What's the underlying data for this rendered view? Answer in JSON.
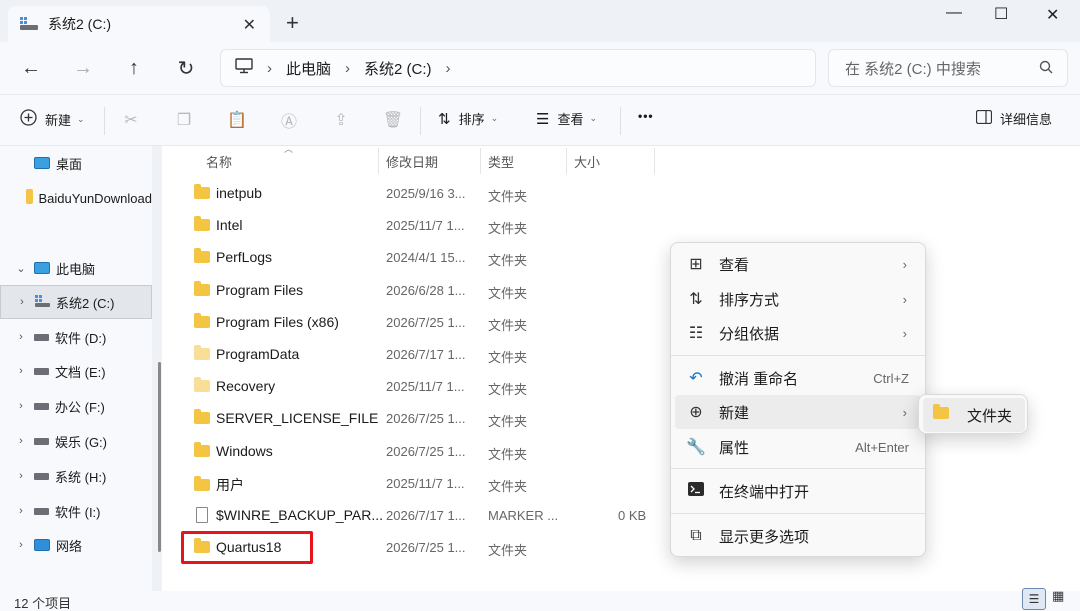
{
  "window": {
    "tab_title": "系统2 (C:)",
    "close_tab": "✕",
    "new_tab": "+",
    "minimize": "—",
    "maximize": "☐",
    "close": "✕"
  },
  "nav": {
    "back": "←",
    "forward": "→",
    "up": "↑",
    "refresh": "↻",
    "breadcrumb": [
      "此电脑",
      "系统2 (C:)"
    ],
    "search_placeholder": "在 系统2 (C:) 中搜索"
  },
  "toolbar": {
    "new_label": "新建",
    "sort_label": "排序",
    "view_label": "查看",
    "more_label": "•••",
    "details_label": "详细信息"
  },
  "sidebar": {
    "items": [
      {
        "label": "桌面"
      },
      {
        "label": "BaiduYunDownload"
      },
      {
        "label": "此电脑"
      },
      {
        "label": "系统2 (C:)"
      },
      {
        "label": "软件 (D:)"
      },
      {
        "label": "文档 (E:)"
      },
      {
        "label": "办公 (F:)"
      },
      {
        "label": "娱乐 (G:)"
      },
      {
        "label": "系统 (H:)"
      },
      {
        "label": "软件 (I:)"
      },
      {
        "label": "网络"
      }
    ]
  },
  "columns": {
    "name": "名称",
    "date": "修改日期",
    "type": "类型",
    "size": "大小"
  },
  "files": [
    {
      "name": "inetpub",
      "date": "2025/9/16 3...",
      "type": "文件夹",
      "size": ""
    },
    {
      "name": "Intel",
      "date": "2025/11/7 1...",
      "type": "文件夹",
      "size": ""
    },
    {
      "name": "PerfLogs",
      "date": "2024/4/1 15...",
      "type": "文件夹",
      "size": ""
    },
    {
      "name": "Program Files",
      "date": "2026/6/28 1...",
      "type": "文件夹",
      "size": ""
    },
    {
      "name": "Program Files (x86)",
      "date": "2026/7/25 1...",
      "type": "文件夹",
      "size": ""
    },
    {
      "name": "ProgramData",
      "date": "2026/7/17 1...",
      "type": "文件夹",
      "size": ""
    },
    {
      "name": "Recovery",
      "date": "2025/11/7 1...",
      "type": "文件夹",
      "size": ""
    },
    {
      "name": "SERVER_LICENSE_FILE",
      "date": "2026/7/25 1...",
      "type": "文件夹",
      "size": ""
    },
    {
      "name": "Windows",
      "date": "2026/7/25 1...",
      "type": "文件夹",
      "size": ""
    },
    {
      "name": "用户",
      "date": "2025/11/7 1...",
      "type": "文件夹",
      "size": ""
    },
    {
      "name": "$WINRE_BACKUP_PAR...",
      "date": "2026/7/17 1...",
      "type": "MARKER ...",
      "size": "0 KB"
    },
    {
      "name": "Quartus18",
      "date": "2026/7/25 1...",
      "type": "文件夹",
      "size": ""
    }
  ],
  "status": {
    "item_count": "12 个项目"
  },
  "context_menu": {
    "items": [
      {
        "label": "查看",
        "shortcut": ""
      },
      {
        "label": "排序方式",
        "shortcut": ""
      },
      {
        "label": "分组依据",
        "shortcut": ""
      },
      {
        "label": "撤消 重命名",
        "shortcut": "Ctrl+Z"
      },
      {
        "label": "新建",
        "shortcut": ""
      },
      {
        "label": "属性",
        "shortcut": "Alt+Enter"
      },
      {
        "label": "在终端中打开",
        "shortcut": ""
      },
      {
        "label": "显示更多选项",
        "shortcut": ""
      }
    ],
    "submenu_item": "文件夹"
  },
  "colors": {
    "accent": "#0067c0",
    "folder": "#f4c443",
    "highlight_box": "#e8141b"
  }
}
